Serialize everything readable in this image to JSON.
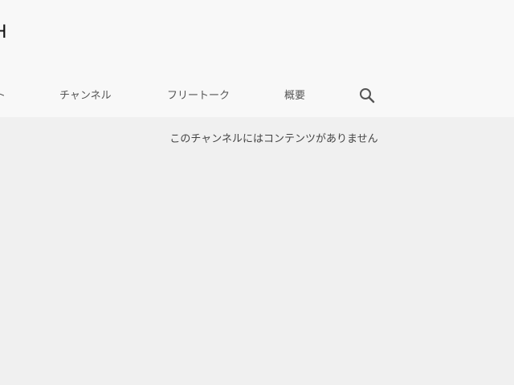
{
  "header": {
    "channel_name": "Ḩ"
  },
  "tabs": [
    {
      "label": "ト",
      "icon": null
    },
    {
      "label": "チャンネル",
      "icon": null
    },
    {
      "label": "フリートーク",
      "icon": null
    },
    {
      "label": "概要",
      "icon": null
    },
    {
      "label": "",
      "icon": "search-icon"
    }
  ],
  "main": {
    "empty_message": "このチャンネルにはコンテンツがありません"
  },
  "colors": {
    "header_bg": "#f8f8f8",
    "page_bg": "#f0f0f0",
    "tab_text": "#555555"
  }
}
